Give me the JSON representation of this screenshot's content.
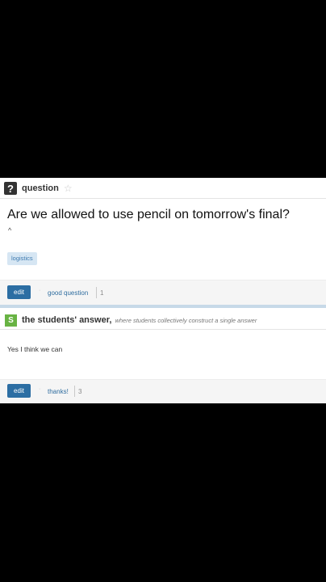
{
  "question": {
    "icon_label": "?",
    "header_title": "question",
    "star_icon": "star-outline-icon",
    "text": "Are we allowed to use pencil on tomorrow's final?",
    "caret": "^",
    "tag": "logistics",
    "footer": {
      "edit_label": "edit",
      "separator": "·",
      "action_label": "good question",
      "count": "1"
    }
  },
  "answer": {
    "icon_label": "S",
    "header_title": "the students' answer,",
    "header_subtitle": "where students collectively construct a single answer",
    "text": "Yes I think we can",
    "footer": {
      "edit_label": "edit",
      "separator": "·",
      "action_label": "thanks!",
      "count": "3"
    }
  },
  "colors": {
    "background": "#000000",
    "panel": "#ffffff",
    "edit_button": "#2c6ea3",
    "link": "#2f6d9f",
    "tag_bg": "#d6e6f3",
    "students_icon": "#68b343"
  }
}
